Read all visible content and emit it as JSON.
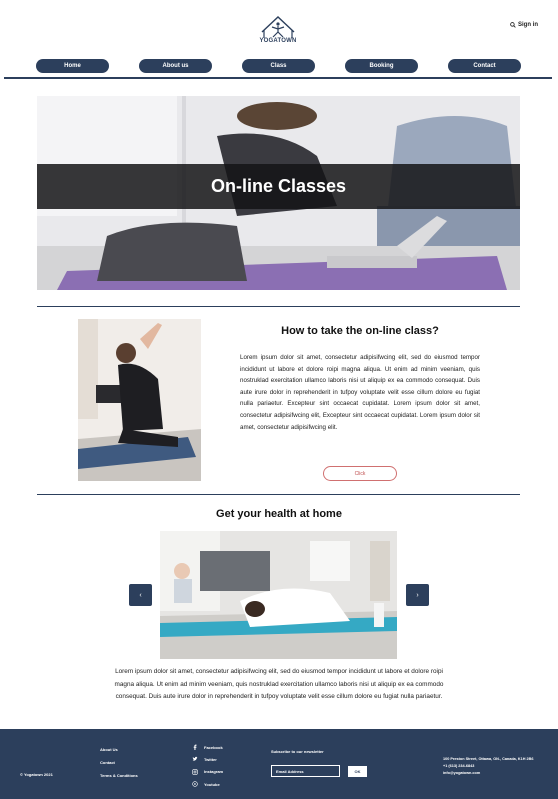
{
  "header": {
    "logo_text": "YOGATOWN",
    "signin": "Sign in"
  },
  "nav": {
    "items": [
      "Home",
      "About us",
      "Class",
      "Booking",
      "Contact"
    ]
  },
  "hero": {
    "title": "On-line Classes"
  },
  "section_howto": {
    "title": "How to take the on-line class?",
    "body": "Lorem ipsum dolor sit amet, consectetur adipisifwcing elit, sed do eiusmod tempor incididunt ut labore et dolore roipi magna aliqua. Ut enim ad minim veeniam, quis nostruklad exercitation ullamco laboris nisi ut aliquip ex ea commodo consequat. Duis aute irure dolor in reprehenderit in tufpoy voluptate velit esse cillum dolore eu fugiat nulla pariaetur. Excepteur sint occaecat cupidatat. Lorem ipsum dolor sit amet, consectetur adipisifwcing elit, Excepteur sint occaecat cupidatat. Lorem ipsum dolor sit amet, consectetur adipisifwcing elit.",
    "button": "Click"
  },
  "section_health": {
    "title": "Get your health at home",
    "prev": "‹",
    "next": "›",
    "body": "Lorem ipsum dolor sit amet, consectetur adipisifwcing elit, sed do eiusmod tempor incididunt ut labore et dolore roipi magna aliqua. Ut enim ad minim veeniam, quis nostruklad exercitation ullamco laboris nisi ut aliquip ex ea commodo consequat. Duis aute irure dolor in reprehenderit in tufpoy voluptate velit esse cillum dolore eu fugiat nulla pariaetur."
  },
  "footer": {
    "copyright": "© Yogatown 2021",
    "links": [
      "About Us",
      "Contact",
      "Terms & Conditions"
    ],
    "social": [
      {
        "icon": "facebook-icon",
        "label": "Facebook"
      },
      {
        "icon": "twitter-icon",
        "label": "Twitter"
      },
      {
        "icon": "instagram-icon",
        "label": "Instagram"
      },
      {
        "icon": "youtube-icon",
        "label": "Youtube"
      }
    ],
    "newsletter_label": "Subscribe to our newsletter",
    "email_placeholder": "Email Address",
    "ok_button": "OK",
    "address_line1": "100 Preston Street, Ottawa, ON., Canada, K1H 2B6",
    "phone": "+1      (613) 234-6843",
    "email": "info@yogatown.com"
  },
  "colors": {
    "primary": "#2c3f5c",
    "accent_button_border": "#d07070"
  }
}
